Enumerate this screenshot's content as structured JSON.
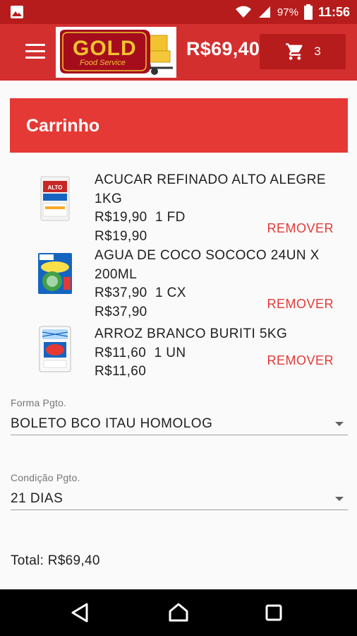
{
  "status_bar": {
    "battery_percent": "97%",
    "time": "11:56",
    "icons": [
      "image-icon",
      "wifi-icon",
      "signal-icon",
      "battery-icon"
    ]
  },
  "app_bar": {
    "logo": {
      "brand": "GOLD",
      "tagline": "Food Service"
    },
    "cart_total": "R$69,40",
    "cart_count": "3",
    "colors": {
      "primary": "#d32f2f",
      "primary_dark": "#b71c1c",
      "accent": "#e53935"
    }
  },
  "page": {
    "title": "Carrinho"
  },
  "cart_items": [
    {
      "name": "ACUCAR REFINADO ALTO ALEGRE 1KG",
      "unit_price": "R$19,90",
      "quantity": "1 FD",
      "subtotal": "R$19,90",
      "remove_label": "REMOVER",
      "image_text": "ALTO ALEGRE"
    },
    {
      "name": "AGUA DE COCO SOCOCO 24UN X 200ML",
      "unit_price": "R$37,90",
      "quantity": "1 CX",
      "subtotal": "R$37,90",
      "remove_label": "REMOVER",
      "image_text": "sococo"
    },
    {
      "name": "ARROZ BRANCO BURITI 5KG",
      "unit_price": "R$11,60",
      "quantity": "1 UN",
      "subtotal": "R$11,60",
      "remove_label": "REMOVER",
      "image_text": "Buriti"
    }
  ],
  "payment_form": {
    "label": "Forma Pgto.",
    "value": "BOLETO BCO ITAU HOMOLOG"
  },
  "payment_condition": {
    "label": "Condição Pgto.",
    "value": "21 DIAS"
  },
  "total": "Total: R$69,40",
  "nav_bar": {
    "icons": [
      "back-icon",
      "home-icon",
      "recents-icon"
    ]
  }
}
